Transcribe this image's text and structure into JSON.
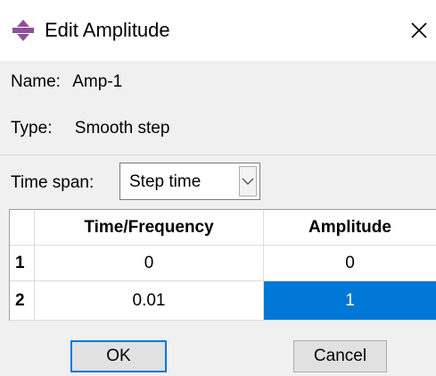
{
  "dialog": {
    "title": "Edit Amplitude",
    "icon": "abaqus-amplitude-icon",
    "close_glyph": "close-icon"
  },
  "fields": {
    "name_label": "Name:",
    "name_value": "Amp-1",
    "type_label": "Type:",
    "type_value": "Smooth step"
  },
  "time_span": {
    "label": "Time span:",
    "selected": "Step time"
  },
  "table": {
    "columns": [
      "Time/Frequency",
      "Amplitude"
    ],
    "rows": [
      {
        "index": "1",
        "time": "0",
        "amplitude": "0"
      },
      {
        "index": "2",
        "time": "0.01",
        "amplitude": "1"
      }
    ],
    "selected_cell": "row 2, Amplitude"
  },
  "buttons": {
    "ok": "OK",
    "cancel": "Cancel"
  },
  "colors": {
    "selection": "#0078d7",
    "dialog_bg": "#f0f0f0",
    "title_bg": "#ffffff"
  }
}
